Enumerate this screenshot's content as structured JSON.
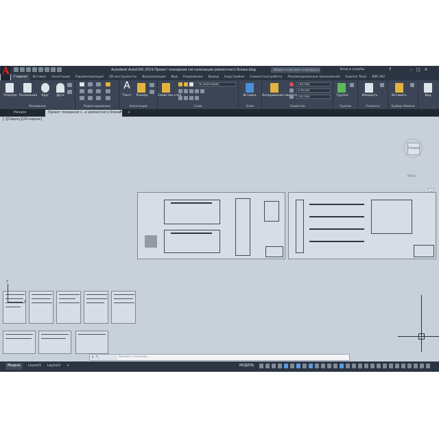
{
  "app": {
    "logo_letter": "A",
    "window_title": "Autodesk AutoCAD 2019   Проект пожарной сигнализации ремонтного блока.dwg",
    "search_placeholder": "Введите ключевое слово/фразу",
    "signin": "Вход в службы",
    "help": "?",
    "minimize": "–",
    "maximize": "□",
    "close": "×"
  },
  "ribbon_tabs": [
    "Главная",
    "Вставка",
    "Аннотации",
    "Параметризация",
    "3D инструменты",
    "Визуализация",
    "Вид",
    "Управление",
    "Вывод",
    "Надстройки",
    "Совместная работа",
    "Рекомендованные приложения",
    "Express Tools",
    "BIM 360"
  ],
  "ribbon": {
    "draw": {
      "title": "Рисование",
      "line": "Отрезок",
      "polyline": "Полилиния",
      "circle": "Круг",
      "arc": "Дуга"
    },
    "modify": {
      "title": "Редактирование"
    },
    "annotation": {
      "title": "Аннотации",
      "text": "Текст",
      "dimension": "Размер"
    },
    "layers": {
      "title": "Слои",
      "layer_properties": "Свойства слоя",
      "layer_dropdown": "По умолчанию"
    },
    "block": {
      "title": "Блок",
      "insert": "Вставка"
    },
    "properties": {
      "title": "Свойства",
      "match": "Копирование свойств",
      "color": "ПоСлою",
      "lineweight": "0.00 мм",
      "linetype": "ПоСлою"
    },
    "groups": {
      "title": "Группы",
      "group": "Группа"
    },
    "utilities": {
      "title": "Утилиты",
      "measure": "Измерить"
    },
    "clipboard": {
      "title": "Буфер обмена",
      "paste": "Вставить"
    },
    "view": {
      "title": "Вид"
    }
  },
  "file_tabs": {
    "start": "Начало",
    "document": "Проект пожарной с...и ремонтного блока*",
    "close": "×",
    "add": "+"
  },
  "canvas": {
    "viewport_label": "[–][Сверху][2D-каркас]",
    "viewcube_face": "Сверху",
    "wcs": "МСК ▾",
    "ucs_y": "Y",
    "ucs_x": "X"
  },
  "command_line": {
    "close": "×",
    "settings": "🔧",
    "prompt": "Введите команду"
  },
  "status_bar": {
    "tabs": [
      "Модель",
      "Layout1",
      "Layout2",
      "+"
    ],
    "model": "МОДЕЛЬ"
  }
}
